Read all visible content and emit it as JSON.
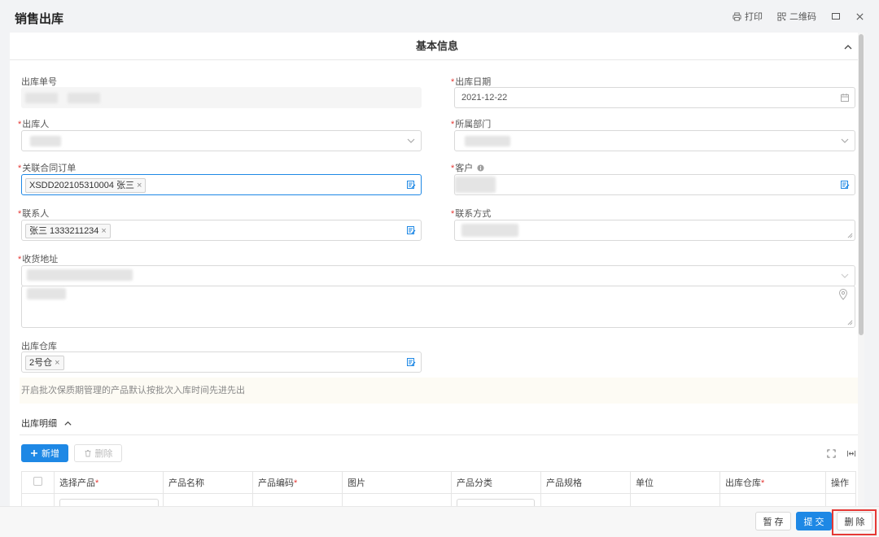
{
  "window": {
    "title": "销售出库",
    "print_label": "打印",
    "qrcode_label": "二维码"
  },
  "section": {
    "title": "基本信息"
  },
  "form": {
    "order_no_label": "出库单号",
    "out_date_label": "出库日期",
    "out_date_value": "2021-12-22",
    "handler_label": "出库人",
    "department_label": "所属部门",
    "contract_label": "关联合同订单",
    "contract_tag": "XSDD202105310004 张三",
    "customer_label": "客户",
    "contact_label": "联系人",
    "contact_tag": "张三 1333211234",
    "contact_method_label": "联系方式",
    "address_label": "收货地址",
    "warehouse_label": "出库仓库",
    "warehouse_tag": "2号仓",
    "required_mark": "*",
    "tag_close": "×"
  },
  "notice": "开启批次保质期管理的产品默认按批次入库时间先进先出",
  "detail": {
    "title": "出库明细",
    "add_label": "新增",
    "delete_label": "删除",
    "columns": [
      "选择产品",
      "产品名称",
      "产品编码",
      "图片",
      "产品分类",
      "产品规格",
      "单位",
      "出库仓库",
      "操作"
    ],
    "required_columns": [
      "选择产品",
      "产品编码",
      "出库仓库"
    ]
  },
  "footer": {
    "save_label": "暂 存",
    "submit_label": "提 交",
    "delete_label": "删 除"
  },
  "colors": {
    "primary": "#1e88e5",
    "required": "#e53935",
    "highlight": "#e53935"
  }
}
